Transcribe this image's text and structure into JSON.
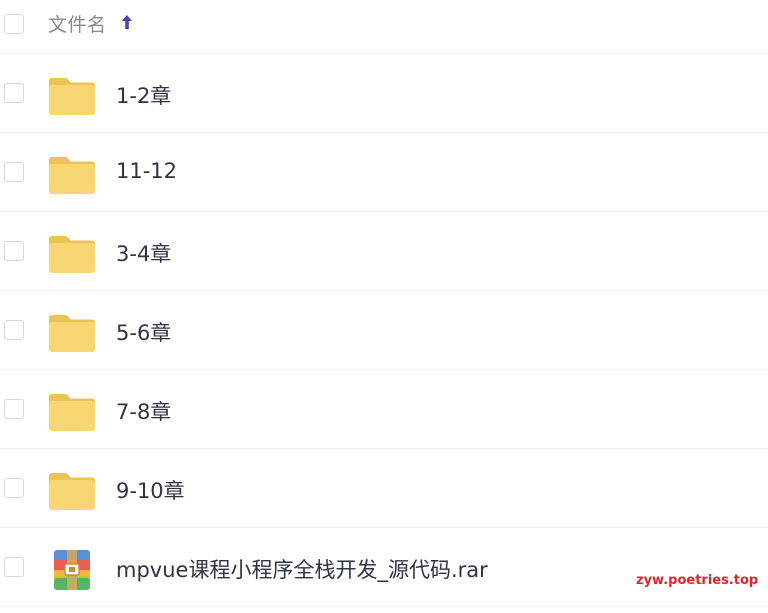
{
  "header": {
    "column_label": "文件名",
    "sort_icon": "arrow-up-icon",
    "accent_color": "#4b46a8"
  },
  "files": [
    {
      "name": "1-2章",
      "type": "folder",
      "icon": "folder-icon"
    },
    {
      "name": "11-12",
      "type": "folder",
      "icon": "folder-icon"
    },
    {
      "name": "3-4章",
      "type": "folder",
      "icon": "folder-icon"
    },
    {
      "name": "5-6章",
      "type": "folder",
      "icon": "folder-icon"
    },
    {
      "name": "7-8章",
      "type": "folder",
      "icon": "folder-icon"
    },
    {
      "name": "9-10章",
      "type": "folder",
      "icon": "folder-icon"
    },
    {
      "name": "mpvue课程小程序全栈开发_源代码.rar",
      "type": "archive",
      "icon": "rar-archive-icon"
    }
  ],
  "colors": {
    "folder": "#f8d674",
    "folder_tab": "#edc355",
    "watermark": "#e0262a"
  },
  "watermark": "zyw.poetries.top"
}
